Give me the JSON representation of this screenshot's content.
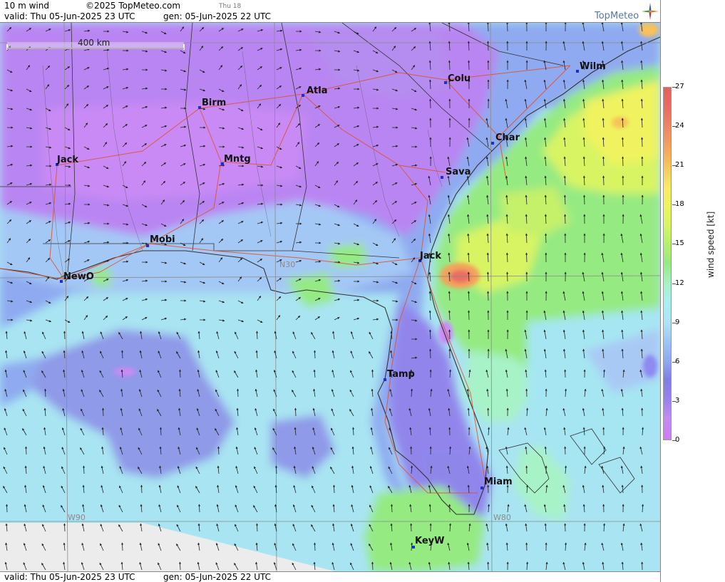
{
  "header": {
    "product": "10 m wind",
    "copyright": "©2025 TopMeteo.com",
    "day_marker": "Thu 18",
    "valid_text": "valid:  Thu  05-Jun-2025  23 UTC",
    "gen_text": "gen: 05-Jun-2025 22 UTC"
  },
  "footer": {
    "valid_text": "valid:  Thu  05-Jun-2025  23 UTC",
    "gen_text": "gen: 05-Jun-2025 22 UTC"
  },
  "logo": {
    "text": "TopMeteo"
  },
  "scale_bar": {
    "label": "400 km"
  },
  "graticule": {
    "lat_label": "N30",
    "lon_labels": [
      "W90",
      "W80"
    ]
  },
  "cities": [
    {
      "name": "Colu"
    },
    {
      "name": "Wilm"
    },
    {
      "name": "Atla"
    },
    {
      "name": "Birm"
    },
    {
      "name": "Char"
    },
    {
      "name": "Jack"
    },
    {
      "name": "Mntg"
    },
    {
      "name": "Sava"
    },
    {
      "name": "Mobi"
    },
    {
      "name": "Jack"
    },
    {
      "name": "NewO"
    },
    {
      "name": "Tamp"
    },
    {
      "name": "Miam"
    },
    {
      "name": "KeyW"
    }
  ],
  "colorbar": {
    "title": "wind speed [kt]",
    "ticks": [
      "27",
      "24",
      "21",
      "18",
      "15",
      "12",
      "9",
      "6",
      "3",
      "0"
    ]
  },
  "colors": {
    "calm": "#c98af5",
    "light": "#8d8af0",
    "moderate": "#a9dff5",
    "fresh": "#9be86e",
    "strong": "#f0f35e",
    "max": "#e6605e",
    "roads": "#e0502a",
    "borders": "#333333"
  }
}
